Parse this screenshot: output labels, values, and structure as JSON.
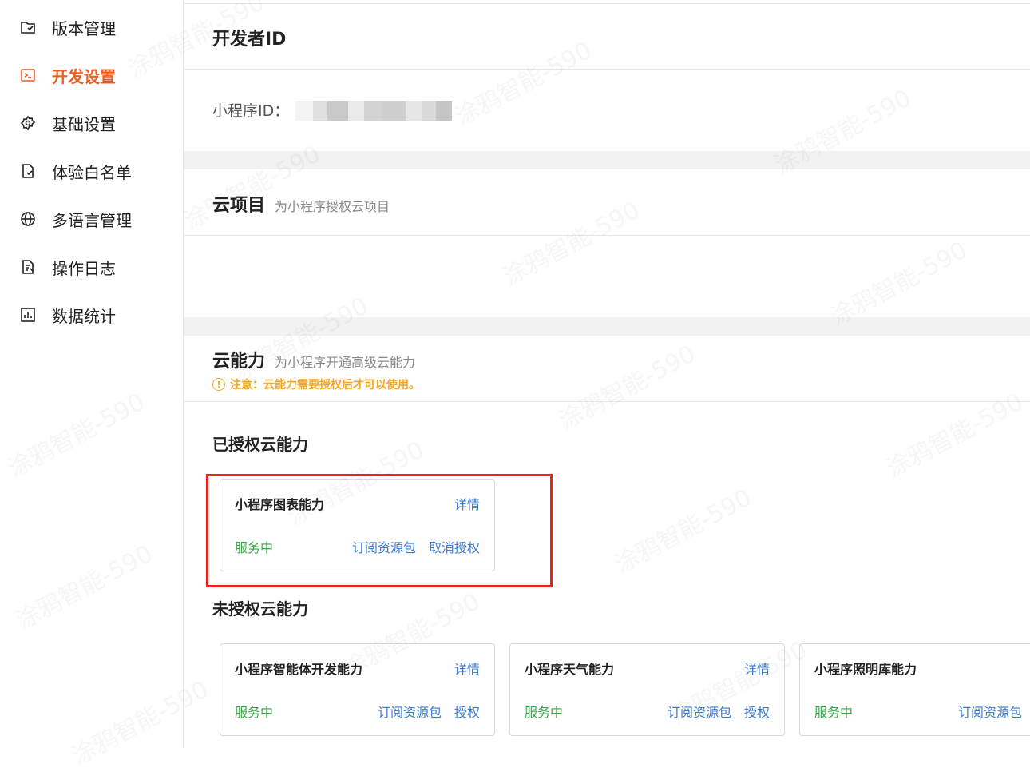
{
  "sidebar": {
    "items": [
      {
        "label": "版本管理",
        "icon": "version-folder-icon"
      },
      {
        "label": "开发设置",
        "icon": "terminal-icon",
        "active": true
      },
      {
        "label": "基础设置",
        "icon": "gear-icon"
      },
      {
        "label": "体验白名单",
        "icon": "file-check-icon"
      },
      {
        "label": "多语言管理",
        "icon": "globe-icon"
      },
      {
        "label": "操作日志",
        "icon": "log-file-icon"
      },
      {
        "label": "数据统计",
        "icon": "bar-chart-icon"
      }
    ]
  },
  "developer": {
    "title": "开发者ID",
    "id_label": "小程序ID："
  },
  "cloud_project": {
    "title": "云项目",
    "subtitle": "为小程序授权云项目"
  },
  "cloud_ability": {
    "title": "云能力",
    "subtitle": "为小程序开通高级云能力",
    "notice": "注意：云能力需要授权后才可以使用。",
    "authorized_title": "已授权云能力",
    "unauthorized_title": "未授权云能力",
    "authorized": [
      {
        "name": "小程序图表能力",
        "detail": "详情",
        "status": "服务中",
        "subscribe": "订阅资源包",
        "action": "取消授权"
      }
    ],
    "unauthorized": [
      {
        "name": "小程序智能体开发能力",
        "detail": "详情",
        "status": "服务中",
        "subscribe": "订阅资源包",
        "action": "授权"
      },
      {
        "name": "小程序天气能力",
        "detail": "详情",
        "status": "服务中",
        "subscribe": "订阅资源包",
        "action": "授权"
      },
      {
        "name": "小程序照明库能力",
        "detail": "",
        "status": "服务中",
        "subscribe": "订阅资源包",
        "action": ""
      }
    ]
  },
  "colors": {
    "accent": "#f05b1f",
    "link": "#3a7bd5",
    "success": "#35a745",
    "warning": "#f5a623",
    "highlight": "#e8241d"
  },
  "watermark": "涂鸦智能-590"
}
